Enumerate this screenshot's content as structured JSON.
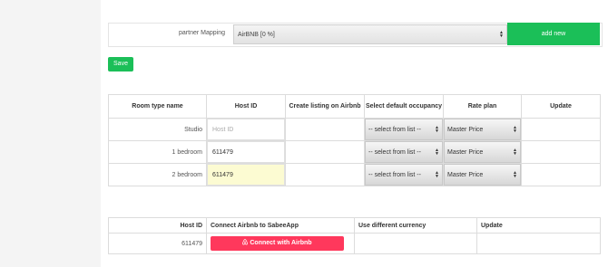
{
  "partner": {
    "label": "partner Mapping",
    "selected": "AirBNB [0 %]",
    "add_new": "add new"
  },
  "save_label": "Save",
  "room_table": {
    "headers": [
      "Room type name",
      "Host ID",
      "Create listing on Airbnb",
      "Select default occupancy",
      "Rate plan",
      "Update"
    ],
    "host_placeholder": "Host ID",
    "rows": [
      {
        "name": "Studio",
        "host_id": "",
        "occupancy": "-- select from list --",
        "rate_plan": "Master Price"
      },
      {
        "name": "1 bedroom",
        "host_id": "611479",
        "occupancy": "-- select from list --",
        "rate_plan": "Master Price"
      },
      {
        "name": "2 bedroom",
        "host_id": "611479",
        "occupancy": "-- select from list --",
        "rate_plan": "Master Price"
      }
    ]
  },
  "connect_table": {
    "headers": [
      "Host ID",
      "Connect Airbnb to SabeeApp",
      "Use different currency",
      "Update"
    ],
    "row": {
      "host_id": "611479",
      "button": "Connect with Airbnb"
    }
  },
  "colors": {
    "accent_green": "#1bbf58",
    "airbnb_red": "#ff385c",
    "focus_bg": "#fcfbd2"
  },
  "icons": {
    "airbnb": "airbnb-logo-icon",
    "select_arrows": "updown-arrows-icon"
  }
}
